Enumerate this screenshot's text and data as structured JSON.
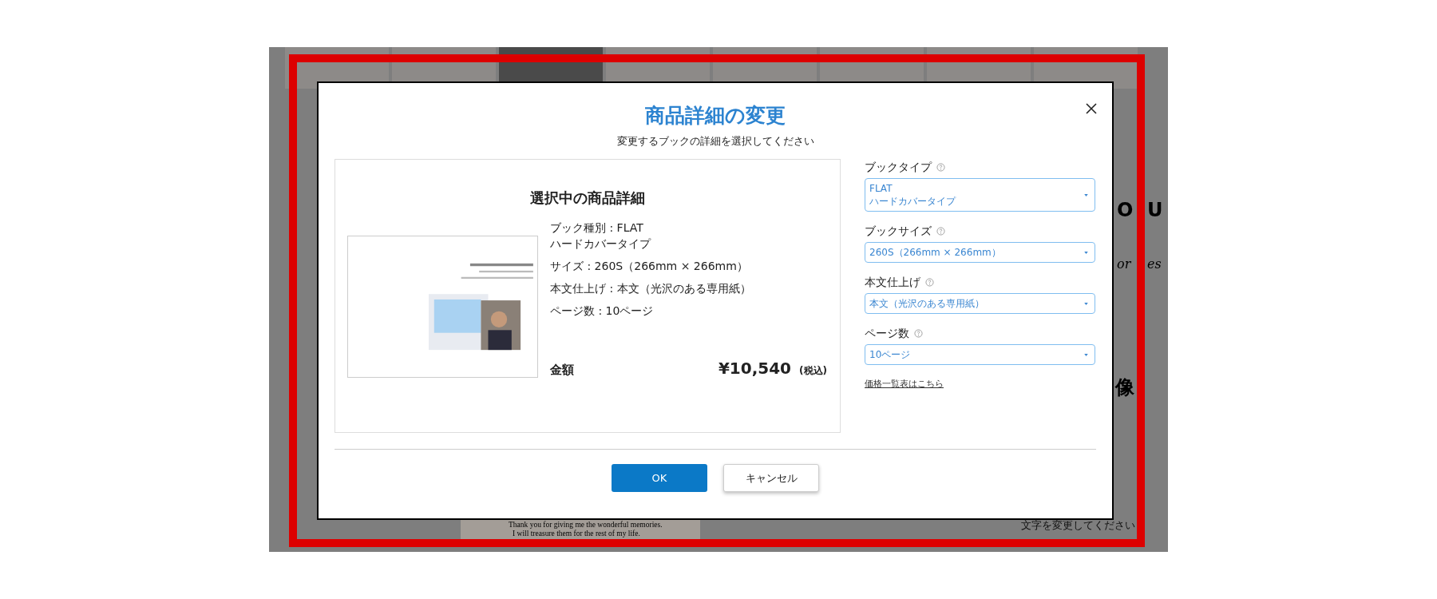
{
  "background": {
    "texts": [
      {
        "kind": "headline",
        "text": "O"
      },
      {
        "kind": "headline",
        "text": "U"
      },
      {
        "kind": "script",
        "text": "or"
      },
      {
        "kind": "script",
        "text": "es"
      },
      {
        "kind": "headline",
        "text": "像"
      },
      {
        "kind": "caption",
        "text": "Thank you for giving me the wonderful memories."
      },
      {
        "kind": "caption",
        "text": "I will treasure them for the rest of my life."
      },
      {
        "kind": "note",
        "text": "文字を変更してください"
      }
    ]
  },
  "dialog": {
    "title": "商品詳細の変更",
    "subtitle": "変更するブックの詳細を選択してください",
    "summary": {
      "heading": "選択中の商品詳細",
      "details": [
        {
          "text": "ブック種別 : FLAT\nハードカバータイプ"
        },
        {
          "text": "サイズ : 260S（266mm × 266mm）"
        },
        {
          "text": "本文仕上げ : 本文（光沢のある専用紙）"
        },
        {
          "text": "ページ数 : 10ページ"
        }
      ],
      "price_label": "金額",
      "price": "¥10,540",
      "tax": "(税込)"
    },
    "options": [
      {
        "label": "ブックタイプ",
        "value": "FLAT\nハードカバータイプ"
      },
      {
        "label": "ブックサイズ",
        "value": "260S（266mm × 266mm）"
      },
      {
        "label": "本文仕上げ",
        "value": "本文（光沢のある専用紙）"
      },
      {
        "label": "ページ数",
        "value": "10ページ"
      }
    ],
    "link": "価格一覧表はこちら",
    "buttons": [
      {
        "kind": "primary",
        "label": "OK"
      },
      {
        "kind": "secondary",
        "label": "キャンセル"
      }
    ]
  }
}
